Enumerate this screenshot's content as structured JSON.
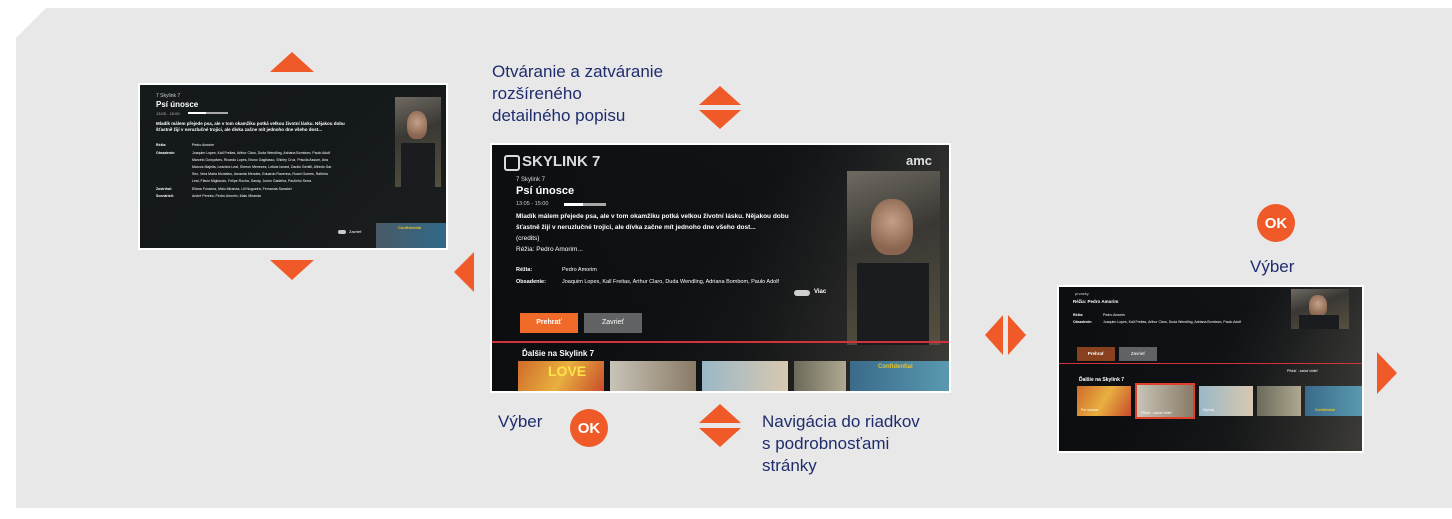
{
  "colors": {
    "accent": "#f05a28",
    "label_text": "#1f2d6e",
    "panel_bg": "#e8e8e8"
  },
  "annotations": {
    "open_close": "Otváranie a zatváranie\nrozšíreného\ndetailného popisu",
    "select_bottom": "Výber",
    "navigation": "Navigácia do riadkov\ns podrobnosťami\nstránky",
    "select_right": "Výber",
    "ok": "OK"
  },
  "detail": {
    "channel": "SKYLINK 7",
    "brand": "amc",
    "breadcrumb": "7  Skylink 7",
    "title": "Psí únosce",
    "time": "13:05 - 15:00",
    "description_1": "Mladík málem přejede psa, ale v tom okamžiku potká velkou životní lásku. Nějakou dobu",
    "description_2": "šťastně žijí v neruzlučné trojici, ale dívka začne mít jednoho dne všeho dost...",
    "credits": "(credits)",
    "director_short": "Réžia: Pedro Amorim...",
    "director_label": "Réžia:",
    "director_value": "Pedro Amorim",
    "cast_label": "Obsadenie:",
    "cast_value": "Joaquim Lopes, Kall Freitas, Arthur Claro, Duda Wendling, Adriana Bombom, Paulo Adolf",
    "more": "Viac",
    "play_button": "Prehrať",
    "close_button": "Zavrieť",
    "row_title": "Ďalšie na Skylink 7",
    "confidential": "Confidential"
  },
  "expanded": {
    "breadcrumb": "7  Skylink 7",
    "title": "Psí únosce",
    "time": "13:05 - 15:00",
    "desc_1": "Mladík málem přejede psa, ale v tom okamžiku potká velkou životní lásku. Nějakou dobu",
    "desc_2": "šťastně žijí v neruzlučné trojici, ale dívka začne mít jednoho dne všeho dost...",
    "director_label": "Réžia:",
    "director_value": "Pedro Amorim",
    "cast_label": "Obsadenie:",
    "cast_lines": [
      "Joaquim Lopes, Kall Freitas, Arthur Claro, Duda Wendling, Adriana Bombom, Paulo Adolf",
      "Marcelo Gonçalves, Ricardo Lopes, Bruno Gagliasso, Shirley Cruz, Priscila Assum, Ana",
      "Marcos Majella, Leandra Leal, Sheron Menezes, Leticia Isnard, Danilo Gentili, Alfredo Gar",
      "Sex, Vera Maria Montalvo, Amanda Mendes, Eduardo Ravenna, Ruani Gomes, Rafinha",
      "Leal, Flávio Migliaccio, Felipe Rocha, Sandy, Junior Gadelha, Paulinho Serra"
    ],
    "producer_label": "Zostrihal:",
    "producer_value": "Eliana Fonseca, Malu Miranda, Lili Nogueira, Fernanda Sanatori",
    "writer_label": "Scenáristi:",
    "writer_value": "André Pereira, Pedro Amorim, Malu Miranda",
    "close": "Zavrieť",
    "confidential": "Confidential"
  },
  "row_view": {
    "label_1": "prvasky",
    "label_2": "Réžia: Pedro Amorim",
    "director_label": "Réžia:",
    "director_value": "Pedro Amorim",
    "cast_label": "Obsadenie:",
    "cast_value": "Joaquim Lopes, Kall Freitas, Arthur Claro, Duda Wendling, Adriana Bombom, Paulo Adolf",
    "play_button": "Prehrať",
    "close_button": "Zavrieť",
    "row_title": "Ďalšie na Skylink 7",
    "right_note": "Přidať - začať vidieť",
    "thumbs": [
      "Psí únosce",
      "Přidať - začať vidieť",
      "Dýchaj",
      "",
      "Confidential"
    ]
  }
}
